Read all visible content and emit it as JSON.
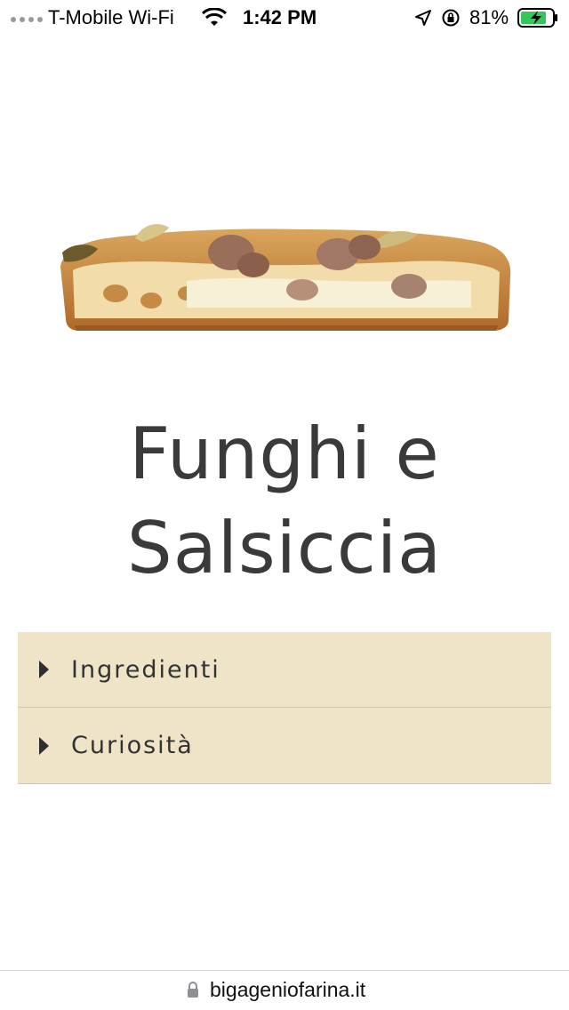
{
  "status_bar": {
    "carrier": "T-Mobile Wi-Fi",
    "time": "1:42 PM",
    "battery_percent": "81%",
    "icons": [
      "signal-dots-icon",
      "wifi-icon",
      "location-arrow-icon",
      "orientation-lock-icon",
      "battery-charging-icon"
    ],
    "battery_color": "#34c759"
  },
  "product": {
    "image_icon": "pizza-slice-image",
    "title": "Funghi e Salsiccia"
  },
  "accordion": {
    "background": "#efe4c8",
    "items": [
      {
        "label": "Ingredienti"
      },
      {
        "label": "Curiosità"
      }
    ]
  },
  "browser": {
    "url": "bigageniofarina.it"
  }
}
